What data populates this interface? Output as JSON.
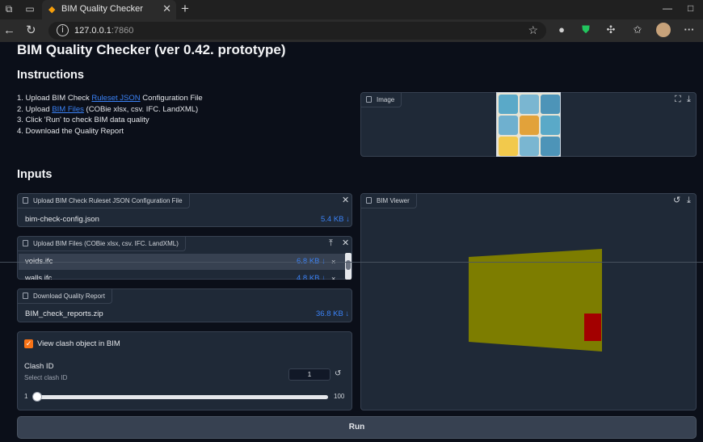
{
  "browser": {
    "tab_title": "BIM Quality Checker",
    "tab_close": "✕",
    "new_tab": "+",
    "url_host": "127.0.0.1",
    "url_port": ":7860",
    "more": "···"
  },
  "page": {
    "title": "BIM Quality Checker (ver 0.42. prototype)",
    "instructions_heading": "Instructions",
    "instructions": {
      "step1_prefix": "1. Upload BIM Check ",
      "step1_link": "Ruleset JSON",
      "step1_suffix": " Configuration File",
      "step2_prefix": "2. Upload ",
      "step2_link": "BIM Files",
      "step2_suffix": " (COBie xlsx, csv. IFC. LandXML)",
      "step3": "3. Click 'Run' to check BIM data quality",
      "step4": "4. Download the Quality Report"
    },
    "inputs_heading": "Inputs"
  },
  "image_panel": {
    "label": "Image"
  },
  "ruleset_panel": {
    "label": "Upload BIM Check Ruleset JSON Configuration File",
    "file_name": "bim-check-config.json",
    "file_size": "5.4 KB ↓"
  },
  "bim_files_panel": {
    "label": "Upload BIM Files (COBie xlsx, csv. IFC. LandXML)",
    "files": [
      {
        "name": "voids.ifc",
        "size": "6.8 KB ↓",
        "remove": "×"
      },
      {
        "name": "walls.ifc",
        "size": "4.8 KB ↓",
        "remove": "×"
      }
    ]
  },
  "report_panel": {
    "label": "Download Quality Report",
    "file_name": "BIM_check_reports.zip",
    "file_size": "36.8 KB ↓"
  },
  "clash_panel": {
    "checkbox_label": "View clash object in BIM",
    "checkbox_checked": true,
    "clash_id_label": "Clash ID",
    "clash_id_sublabel": "Select clash ID",
    "clash_id_value": "1",
    "slider_min": "1",
    "slider_max": "100",
    "slider_value": 1
  },
  "bim_viewer": {
    "label": "BIM Viewer",
    "wall_color": "#7d7d00",
    "clash_color": "#a30000"
  },
  "run_button": {
    "label": "Run"
  },
  "colors": {
    "background": "#0b0f19",
    "panel": "#1f2937",
    "link": "#3b82f6",
    "accent": "#f97316"
  }
}
